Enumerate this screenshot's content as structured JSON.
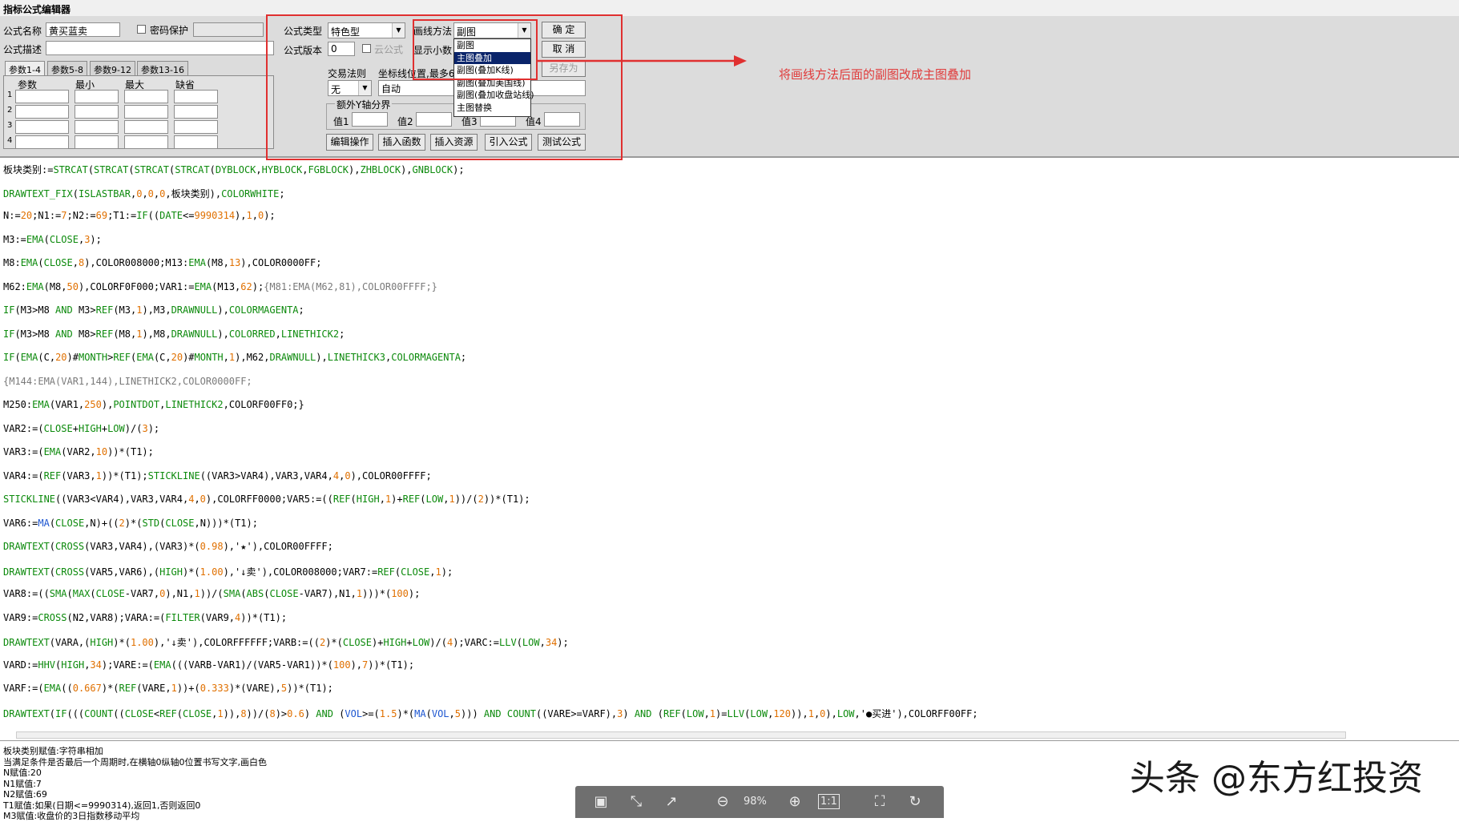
{
  "window": {
    "title": "指标公式编辑器"
  },
  "form": {
    "name_label": "公式名称",
    "name_value": "黄买蓝卖",
    "password_label": "密码保护",
    "desc_label": "公式描述",
    "type_label": "公式类型",
    "type_value": "特色型",
    "version_label": "公式版本",
    "version_value": "0",
    "cloud_label": "云公式",
    "draw_method_label": "画线方法",
    "draw_method_value": "副图",
    "decimal_label": "显示小数",
    "trade_rule_label": "交易法则",
    "trade_rule_value": "无",
    "coord_label": "坐标线位置,最多6",
    "coord_value": "自动",
    "y_axis_label": "额外Y轴分界",
    "val1_label": "值1",
    "val2_label": "值2",
    "val3_label": "值3",
    "val4_label": "值4"
  },
  "tabs": [
    "参数1-4",
    "参数5-8",
    "参数9-12",
    "参数13-16"
  ],
  "param_headers": [
    "参数",
    "最小",
    "最大",
    "缺省"
  ],
  "param_rows": [
    "1",
    "2",
    "3",
    "4"
  ],
  "buttons": {
    "ok": "确 定",
    "cancel": "取 消",
    "save_as": "另存为",
    "edit_ops": "编辑操作",
    "insert_func": "插入函数",
    "insert_res": "插入资源",
    "import_formula": "引入公式",
    "test_formula": "测试公式"
  },
  "draw_method_options": [
    "副图",
    "主图叠加",
    "副图(叠加K线)",
    "副图(叠加美国线)",
    "副图(叠加收盘站线)",
    "主图替换"
  ],
  "draw_method_highlight_index": 1,
  "annotation": "将画线方法后面的副图改成主图叠加",
  "code_lines": [
    [
      [
        "板块类别:=",
        ""
      ],
      [
        "STRCAT",
        "f"
      ],
      [
        "(",
        ""
      ],
      [
        "STRCAT",
        "f"
      ],
      [
        "(",
        ""
      ],
      [
        "STRCAT",
        "f"
      ],
      [
        "(",
        ""
      ],
      [
        "STRCAT",
        "f"
      ],
      [
        "(",
        ""
      ],
      [
        "DYBLOCK",
        "f"
      ],
      [
        ",",
        ""
      ],
      [
        "HYBLOCK",
        "f"
      ],
      [
        ",",
        ""
      ],
      [
        "FGBLOCK",
        "f"
      ],
      [
        "),",
        ""
      ],
      [
        "ZHBLOCK",
        "f"
      ],
      [
        "),",
        ""
      ],
      [
        "GNBLOCK",
        "f"
      ],
      [
        ");",
        ""
      ]
    ],
    [
      [
        "DRAWTEXT_FIX",
        "f"
      ],
      [
        "(",
        ""
      ],
      [
        "ISLASTBAR",
        "f"
      ],
      [
        ",",
        ""
      ],
      [
        "0",
        "n"
      ],
      [
        ",",
        ""
      ],
      [
        "0",
        "n"
      ],
      [
        ",",
        ""
      ],
      [
        "0",
        "n"
      ],
      [
        ",板块类别),",
        ""
      ],
      [
        "COLORWHITE",
        "f"
      ],
      [
        ";",
        ""
      ]
    ],
    [
      [
        "N:=",
        ""
      ],
      [
        "20",
        "n"
      ],
      [
        ";N1:=",
        ""
      ],
      [
        "7",
        "n"
      ],
      [
        ";N2:=",
        ""
      ],
      [
        "69",
        "n"
      ],
      [
        ";T1:=",
        ""
      ],
      [
        "IF",
        "f"
      ],
      [
        "((",
        ""
      ],
      [
        "DATE",
        "f"
      ],
      [
        "<=",
        ""
      ],
      [
        "9990314",
        "n"
      ],
      [
        "),",
        ""
      ],
      [
        "1",
        "n"
      ],
      [
        ",",
        ""
      ],
      [
        "0",
        "n"
      ],
      [
        ");",
        ""
      ]
    ],
    [
      [
        "M3:=",
        ""
      ],
      [
        "EMA",
        "f"
      ],
      [
        "(",
        ""
      ],
      [
        "CLOSE",
        "f"
      ],
      [
        ",",
        ""
      ],
      [
        "3",
        "n"
      ],
      [
        ");",
        ""
      ]
    ],
    [
      [
        "M8:",
        ""
      ],
      [
        "EMA",
        "f"
      ],
      [
        "(",
        ""
      ],
      [
        "CLOSE",
        "f"
      ],
      [
        ",",
        ""
      ],
      [
        "8",
        "n"
      ],
      [
        "),COLOR008000;M13:",
        ""
      ],
      [
        "EMA",
        "f"
      ],
      [
        "(M8,",
        ""
      ],
      [
        "13",
        "n"
      ],
      [
        "),COLOR0000FF;",
        ""
      ]
    ],
    [
      [
        "M62:",
        ""
      ],
      [
        "EMA",
        "f"
      ],
      [
        "(M8,",
        ""
      ],
      [
        "50",
        "n"
      ],
      [
        "),COLORF0F000;VAR1:=",
        ""
      ],
      [
        "EMA",
        "f"
      ],
      [
        "(M13,",
        ""
      ],
      [
        "62",
        "n"
      ],
      [
        ");",
        ""
      ],
      [
        "{M81:EMA(M62,81),COLOR00FFFF;}",
        "c"
      ]
    ],
    [
      [
        "IF",
        "f"
      ],
      [
        "(M3>M8 ",
        ""
      ],
      [
        "AND",
        "f"
      ],
      [
        " M3>",
        ""
      ],
      [
        "REF",
        "f"
      ],
      [
        "(M3,",
        ""
      ],
      [
        "1",
        "n"
      ],
      [
        "),M3,",
        ""
      ],
      [
        "DRAWNULL",
        "f"
      ],
      [
        "),",
        ""
      ],
      [
        "COLORMAGENTA",
        "f"
      ],
      [
        ";",
        ""
      ]
    ],
    [
      [
        "IF",
        "f"
      ],
      [
        "(M3>M8 ",
        ""
      ],
      [
        "AND",
        "f"
      ],
      [
        " M8>",
        ""
      ],
      [
        "REF",
        "f"
      ],
      [
        "(M8,",
        ""
      ],
      [
        "1",
        "n"
      ],
      [
        "),M8,",
        ""
      ],
      [
        "DRAWNULL",
        "f"
      ],
      [
        "),",
        ""
      ],
      [
        "COLORRED",
        "f"
      ],
      [
        ",",
        ""
      ],
      [
        "LINETHICK2",
        "f"
      ],
      [
        ";",
        ""
      ]
    ],
    [
      [
        "IF",
        "f"
      ],
      [
        "(",
        ""
      ],
      [
        "EMA",
        "f"
      ],
      [
        "(C,",
        ""
      ],
      [
        "20",
        "n"
      ],
      [
        ")#",
        ""
      ],
      [
        "MONTH",
        "f"
      ],
      [
        ">",
        ""
      ],
      [
        "REF",
        "f"
      ],
      [
        "(",
        ""
      ],
      [
        "EMA",
        "f"
      ],
      [
        "(C,",
        ""
      ],
      [
        "20",
        "n"
      ],
      [
        ")#",
        ""
      ],
      [
        "MONTH",
        "f"
      ],
      [
        ",",
        ""
      ],
      [
        "1",
        "n"
      ],
      [
        "),M62,",
        ""
      ],
      [
        "DRAWNULL",
        "f"
      ],
      [
        "),",
        ""
      ],
      [
        "LINETHICK3",
        "f"
      ],
      [
        ",",
        ""
      ],
      [
        "COLORMAGENTA",
        "f"
      ],
      [
        ";",
        ""
      ]
    ],
    [
      [
        "{M144:EMA(VAR1,144),LINETHICK2,COLOR0000FF;",
        "c"
      ]
    ],
    [
      [
        "M250:",
        ""
      ],
      [
        "EMA",
        "f"
      ],
      [
        "(VAR1,",
        ""
      ],
      [
        "250",
        "n"
      ],
      [
        "),",
        ""
      ],
      [
        "POINTDOT",
        "f"
      ],
      [
        ",",
        ""
      ],
      [
        "LINETHICK2",
        "f"
      ],
      [
        ",COLORF00FF0;}",
        ""
      ]
    ],
    [
      [
        "VAR2:=(",
        ""
      ],
      [
        "CLOSE",
        "f"
      ],
      [
        "+",
        ""
      ],
      [
        "HIGH",
        "f"
      ],
      [
        "+",
        ""
      ],
      [
        "LOW",
        "f"
      ],
      [
        ")/(",
        ""
      ],
      [
        "3",
        "n"
      ],
      [
        ");",
        ""
      ]
    ],
    [
      [
        "VAR3:=(",
        ""
      ],
      [
        "EMA",
        "f"
      ],
      [
        "(VAR2,",
        ""
      ],
      [
        "10",
        "n"
      ],
      [
        "))*(T1);",
        ""
      ]
    ],
    [
      [
        "VAR4:=(",
        ""
      ],
      [
        "REF",
        "f"
      ],
      [
        "(VAR3,",
        ""
      ],
      [
        "1",
        "n"
      ],
      [
        "))*(T1);",
        ""
      ],
      [
        "STICKLINE",
        "f"
      ],
      [
        "((VAR3>VAR4),VAR3,VAR4,",
        ""
      ],
      [
        "4",
        "n"
      ],
      [
        ",",
        ""
      ],
      [
        "0",
        "n"
      ],
      [
        "),COLOR00FFFF;",
        ""
      ]
    ],
    [
      [
        "STICKLINE",
        "f"
      ],
      [
        "((VAR3<VAR4),VAR3,VAR4,",
        ""
      ],
      [
        "4",
        "n"
      ],
      [
        ",",
        ""
      ],
      [
        "0",
        "n"
      ],
      [
        "),COLORFF0000;VAR5:=((",
        ""
      ],
      [
        "REF",
        "f"
      ],
      [
        "(",
        ""
      ],
      [
        "HIGH",
        "f"
      ],
      [
        ",",
        ""
      ],
      [
        "1",
        "n"
      ],
      [
        ")+",
        ""
      ],
      [
        "REF",
        "f"
      ],
      [
        "(",
        ""
      ],
      [
        "LOW",
        "f"
      ],
      [
        ",",
        ""
      ],
      [
        "1",
        "n"
      ],
      [
        "))/(",
        ""
      ],
      [
        "2",
        "n"
      ],
      [
        "))*(T1);",
        ""
      ]
    ],
    [
      [
        "VAR6:=",
        ""
      ],
      [
        "MA",
        "b"
      ],
      [
        "(",
        ""
      ],
      [
        "CLOSE",
        "f"
      ],
      [
        ",N)+((",
        ""
      ],
      [
        "2",
        "n"
      ],
      [
        ")*(",
        ""
      ],
      [
        "STD",
        "f"
      ],
      [
        "(",
        ""
      ],
      [
        "CLOSE",
        "f"
      ],
      [
        ",N)))*(T1);",
        ""
      ]
    ],
    [
      [
        "DRAWTEXT",
        "f"
      ],
      [
        "(",
        ""
      ],
      [
        "CROSS",
        "f"
      ],
      [
        "(VAR3,VAR4),(VAR3)*(",
        ""
      ],
      [
        "0.98",
        "n"
      ],
      [
        "),'★'),COLOR00FFFF;",
        ""
      ]
    ],
    [
      [
        "DRAWTEXT",
        "f"
      ],
      [
        "(",
        ""
      ],
      [
        "CROSS",
        "f"
      ],
      [
        "(VAR5,VAR6),(",
        ""
      ],
      [
        "HIGH",
        "f"
      ],
      [
        ")*(",
        ""
      ],
      [
        "1.00",
        "n"
      ],
      [
        "),'↓卖'),COLOR008000;VAR7:=",
        ""
      ],
      [
        "REF",
        "f"
      ],
      [
        "(",
        ""
      ],
      [
        "CLOSE",
        "f"
      ],
      [
        ",",
        ""
      ],
      [
        "1",
        "n"
      ],
      [
        ");",
        ""
      ]
    ],
    [
      [
        "VAR8:=((",
        ""
      ],
      [
        "SMA",
        "f"
      ],
      [
        "(",
        ""
      ],
      [
        "MAX",
        "f"
      ],
      [
        "(",
        ""
      ],
      [
        "CLOSE",
        "f"
      ],
      [
        "-VAR7,",
        ""
      ],
      [
        "0",
        "n"
      ],
      [
        "),N1,",
        ""
      ],
      [
        "1",
        "n"
      ],
      [
        "))/(",
        ""
      ],
      [
        "SMA",
        "f"
      ],
      [
        "(",
        ""
      ],
      [
        "ABS",
        "f"
      ],
      [
        "(",
        ""
      ],
      [
        "CLOSE",
        "f"
      ],
      [
        "-VAR7),N1,",
        ""
      ],
      [
        "1",
        "n"
      ],
      [
        ")))*(",
        ""
      ],
      [
        "100",
        "n"
      ],
      [
        ");",
        ""
      ]
    ],
    [
      [
        "VAR9:=",
        ""
      ],
      [
        "CROSS",
        "f"
      ],
      [
        "(N2,VAR8);VARA:=(",
        ""
      ],
      [
        "FILTER",
        "f"
      ],
      [
        "(VAR9,",
        ""
      ],
      [
        "4",
        "n"
      ],
      [
        "))*(T1);",
        ""
      ]
    ],
    [
      [
        "DRAWTEXT",
        "f"
      ],
      [
        "(VARA,(",
        ""
      ],
      [
        "HIGH",
        "f"
      ],
      [
        ")*(",
        ""
      ],
      [
        "1.00",
        "n"
      ],
      [
        "),'↓卖'),COLORFFFFFF;VARB:=((",
        ""
      ],
      [
        "2",
        "n"
      ],
      [
        ")*(",
        ""
      ],
      [
        "CLOSE",
        "f"
      ],
      [
        ")+",
        ""
      ],
      [
        "HIGH",
        "f"
      ],
      [
        "+",
        ""
      ],
      [
        "LOW",
        "f"
      ],
      [
        ")/(",
        ""
      ],
      [
        "4",
        "n"
      ],
      [
        ");VARC:=",
        ""
      ],
      [
        "LLV",
        "f"
      ],
      [
        "(",
        ""
      ],
      [
        "LOW",
        "f"
      ],
      [
        ",",
        ""
      ],
      [
        "34",
        "n"
      ],
      [
        ");",
        ""
      ]
    ],
    [
      [
        "VARD:=",
        ""
      ],
      [
        "HHV",
        "f"
      ],
      [
        "(",
        ""
      ],
      [
        "HIGH",
        "f"
      ],
      [
        ",",
        ""
      ],
      [
        "34",
        "n"
      ],
      [
        ");VARE:=(",
        ""
      ],
      [
        "EMA",
        "f"
      ],
      [
        "(((VARB-VAR1)/(VAR5-VAR1))*(",
        ""
      ],
      [
        "100",
        "n"
      ],
      [
        "),",
        ""
      ],
      [
        "7",
        "n"
      ],
      [
        "))*(T1);",
        ""
      ]
    ],
    [
      [
        "VARF:=(",
        ""
      ],
      [
        "EMA",
        "f"
      ],
      [
        "((",
        ""
      ],
      [
        "0.667",
        "n"
      ],
      [
        ")*(",
        ""
      ],
      [
        "REF",
        "f"
      ],
      [
        "(VARE,",
        ""
      ],
      [
        "1",
        "n"
      ],
      [
        "))+(",
        ""
      ],
      [
        "0.333",
        "n"
      ],
      [
        ")*(VARE),",
        ""
      ],
      [
        "5",
        "n"
      ],
      [
        "))*(T1);",
        ""
      ]
    ],
    [
      [
        "DRAWTEXT",
        "f"
      ],
      [
        "(",
        ""
      ],
      [
        "IF",
        "f"
      ],
      [
        "(((",
        ""
      ],
      [
        "COUNT",
        "f"
      ],
      [
        "((",
        ""
      ],
      [
        "CLOSE",
        "f"
      ],
      [
        "<",
        ""
      ],
      [
        "REF",
        "f"
      ],
      [
        "(",
        ""
      ],
      [
        "CLOSE",
        "f"
      ],
      [
        ",",
        ""
      ],
      [
        "1",
        "n"
      ],
      [
        ")),",
        ""
      ],
      [
        "8",
        "n"
      ],
      [
        "))/(",
        ""
      ],
      [
        "8",
        "n"
      ],
      [
        ")>",
        ""
      ],
      [
        "0.6",
        "n"
      ],
      [
        ") ",
        ""
      ],
      [
        "AND",
        "f"
      ],
      [
        " (",
        ""
      ],
      [
        "VOL",
        "b"
      ],
      [
        ">=(",
        ""
      ],
      [
        "1.5",
        "n"
      ],
      [
        ")*(",
        ""
      ],
      [
        "MA",
        "b"
      ],
      [
        "(",
        ""
      ],
      [
        "VOL",
        "b"
      ],
      [
        ",",
        ""
      ],
      [
        "5",
        "n"
      ],
      [
        "))) ",
        ""
      ],
      [
        "AND",
        "f"
      ],
      [
        " ",
        ""
      ],
      [
        "COUNT",
        "f"
      ],
      [
        "((VARE>=VARF),",
        ""
      ],
      [
        "3",
        "n"
      ],
      [
        ") ",
        ""
      ],
      [
        "AND",
        "f"
      ],
      [
        " (",
        ""
      ],
      [
        "REF",
        "f"
      ],
      [
        "(",
        ""
      ],
      [
        "LOW",
        "f"
      ],
      [
        ",",
        ""
      ],
      [
        "1",
        "n"
      ],
      [
        ")=",
        ""
      ],
      [
        "LLV",
        "f"
      ],
      [
        "(",
        ""
      ],
      [
        "LOW",
        "f"
      ],
      [
        ",",
        ""
      ],
      [
        "120",
        "n"
      ],
      [
        ")),",
        ""
      ],
      [
        "1",
        "n"
      ],
      [
        ",",
        ""
      ],
      [
        "0",
        "n"
      ],
      [
        "),",
        ""
      ],
      [
        "LOW",
        "f"
      ],
      [
        ",'●买进'),COLORFF00FF;",
        ""
      ]
    ]
  ],
  "hints": [
    "板块类别赋值:字符串相加",
    "当满足条件是否最后一个周期时,在横轴0纵轴0位置书写文字,画白色",
    "N赋值:20",
    "N1赋值:7",
    "N2赋值:69",
    "T1赋值:如果(日期<=9990314),返回1,否则返回0",
    "M3赋值:收盘价的3日指数移动平均"
  ],
  "viewer": {
    "zoom": "98%",
    "actual_size": "1:1"
  },
  "watermark": "头条 @东方红投资",
  "colors": {
    "red_box": "#e03030",
    "func_green": "#0c8a0c",
    "number_orange": "#e07000",
    "comment_gray": "#7a7a7a"
  }
}
